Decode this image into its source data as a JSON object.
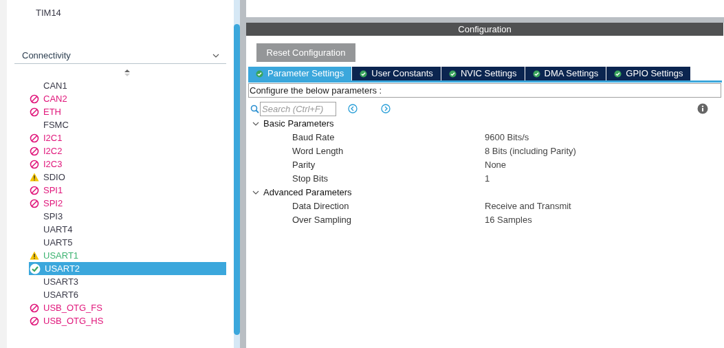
{
  "sidebar": {
    "items_above": [
      "TIM14"
    ],
    "category": {
      "label": "Connectivity",
      "expanded": true
    },
    "items": [
      {
        "label": "CAN1",
        "kind": "none",
        "selected": false
      },
      {
        "label": "CAN2",
        "kind": "blocked",
        "selected": false
      },
      {
        "label": "ETH",
        "kind": "blocked",
        "selected": false
      },
      {
        "label": "FSMC",
        "kind": "none",
        "selected": false
      },
      {
        "label": "I2C1",
        "kind": "blocked",
        "selected": false
      },
      {
        "label": "I2C2",
        "kind": "blocked",
        "selected": false
      },
      {
        "label": "I2C3",
        "kind": "blocked",
        "selected": false
      },
      {
        "label": "SDIO",
        "kind": "warning",
        "selected": false
      },
      {
        "label": "SPI1",
        "kind": "blocked",
        "selected": false
      },
      {
        "label": "SPI2",
        "kind": "blocked",
        "selected": false
      },
      {
        "label": "SPI3",
        "kind": "none",
        "selected": false
      },
      {
        "label": "UART4",
        "kind": "none",
        "selected": false
      },
      {
        "label": "UART5",
        "kind": "none",
        "selected": false
      },
      {
        "label": "USART1",
        "kind": "partial",
        "selected": false
      },
      {
        "label": "USART2",
        "kind": "ok",
        "selected": true
      },
      {
        "label": "USART3",
        "kind": "none",
        "selected": false
      },
      {
        "label": "USART6",
        "kind": "none",
        "selected": false
      },
      {
        "label": "USB_OTG_FS",
        "kind": "blocked",
        "selected": false
      },
      {
        "label": "USB_OTG_HS",
        "kind": "blocked",
        "selected": false
      }
    ]
  },
  "configuration": {
    "title": "Configuration",
    "reset_button": "Reset Configuration",
    "tabs": [
      {
        "label": "Parameter Settings",
        "selected": true
      },
      {
        "label": "User Constants",
        "selected": false
      },
      {
        "label": "NVIC Settings",
        "selected": false
      },
      {
        "label": "DMA Settings",
        "selected": false
      },
      {
        "label": "GPIO Settings",
        "selected": false
      }
    ],
    "hint": "Configure the below parameters :",
    "search": {
      "placeholder": "Search (Ctrl+F)"
    },
    "groups": [
      {
        "label": "Basic Parameters",
        "expanded": true,
        "params": [
          {
            "name": "Baud Rate",
            "value": "9600 Bits/s"
          },
          {
            "name": "Word Length",
            "value": "8 Bits (including Parity)"
          },
          {
            "name": "Parity",
            "value": "None"
          },
          {
            "name": "Stop Bits",
            "value": "1"
          }
        ]
      },
      {
        "label": "Advanced Parameters",
        "expanded": true,
        "params": [
          {
            "name": "Data Direction",
            "value": "Receive and Transmit"
          },
          {
            "name": "Over Sampling",
            "value": "16 Samples"
          }
        ]
      }
    ]
  }
}
